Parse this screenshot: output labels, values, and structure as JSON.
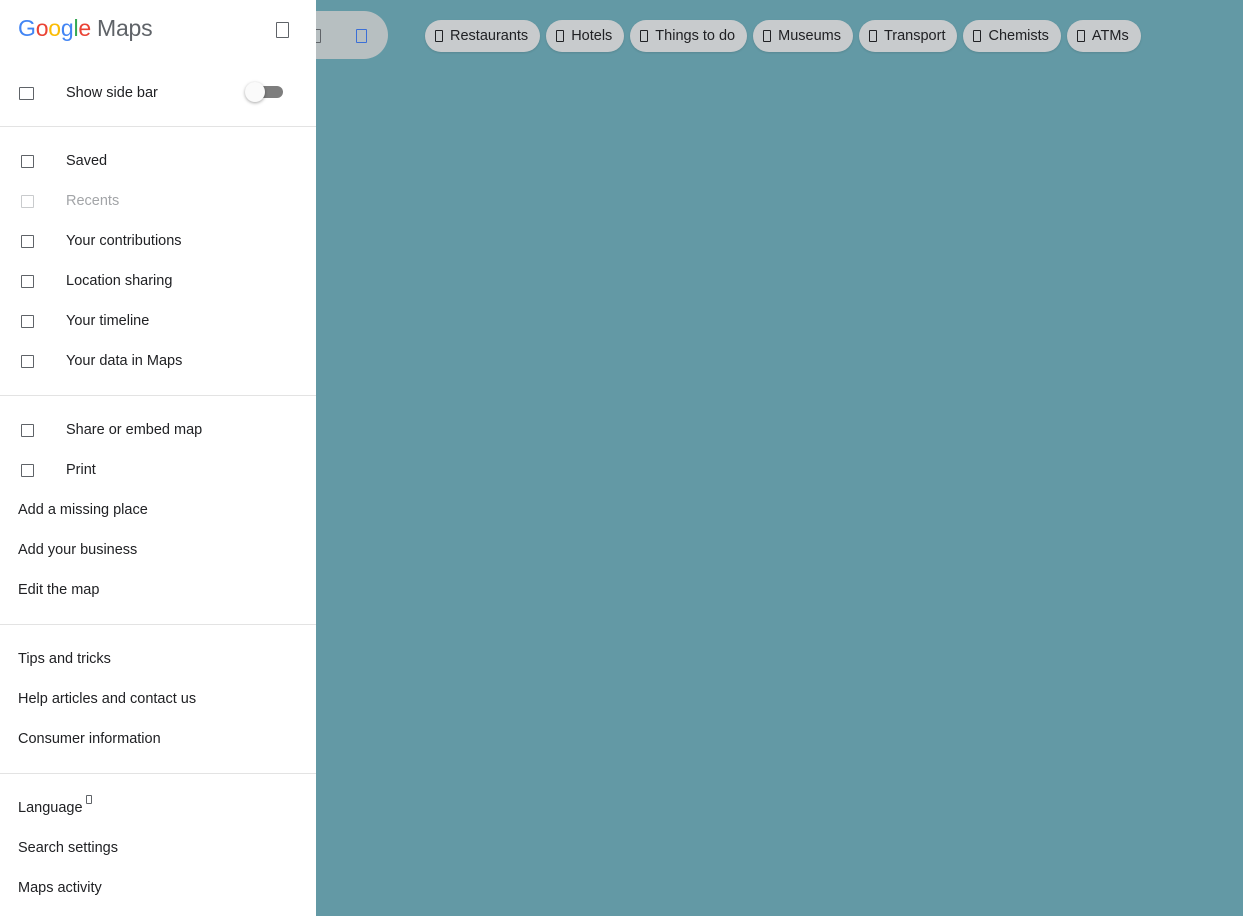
{
  "app": {
    "logo_letters": [
      "G",
      "o",
      "o",
      "g",
      "l",
      "e"
    ],
    "logo_product": "Maps"
  },
  "panel": {
    "show_sidebar": {
      "label": "Show side bar",
      "enabled": false
    },
    "section1": [
      {
        "label": "Saved",
        "icon": "bookmark-icon",
        "disabled": false
      },
      {
        "label": "Recents",
        "icon": "history-icon",
        "disabled": true
      },
      {
        "label": "Your contributions",
        "icon": "contributions-icon",
        "disabled": false
      },
      {
        "label": "Location sharing",
        "icon": "location-sharing-icon",
        "disabled": false
      },
      {
        "label": "Your timeline",
        "icon": "timeline-icon",
        "disabled": false
      },
      {
        "label": "Your data in Maps",
        "icon": "shield-icon",
        "disabled": false
      }
    ],
    "section2": {
      "share": "Share or embed map",
      "print": "Print",
      "add_missing_place": "Add a missing place",
      "add_business": "Add your business",
      "edit_map": "Edit the map"
    },
    "section3": {
      "tips": "Tips and tricks",
      "help": "Help articles and contact us",
      "consumer": "Consumer information"
    },
    "section4": {
      "language": "Language",
      "search_settings": "Search settings",
      "maps_activity": "Maps activity"
    }
  },
  "chips": [
    {
      "label": "Restaurants",
      "icon": "restaurant-icon"
    },
    {
      "label": "Hotels",
      "icon": "hotel-icon"
    },
    {
      "label": "Things to do",
      "icon": "things-to-do-icon"
    },
    {
      "label": "Museums",
      "icon": "museum-icon"
    },
    {
      "label": "Transport",
      "icon": "transport-icon"
    },
    {
      "label": "Chemists",
      "icon": "pharmacy-icon"
    },
    {
      "label": "ATMs",
      "icon": "atm-icon"
    }
  ],
  "colors": {
    "map_background": "#6399a5",
    "panel_background": "#ffffff",
    "chip_background": "#c8cbcd"
  }
}
